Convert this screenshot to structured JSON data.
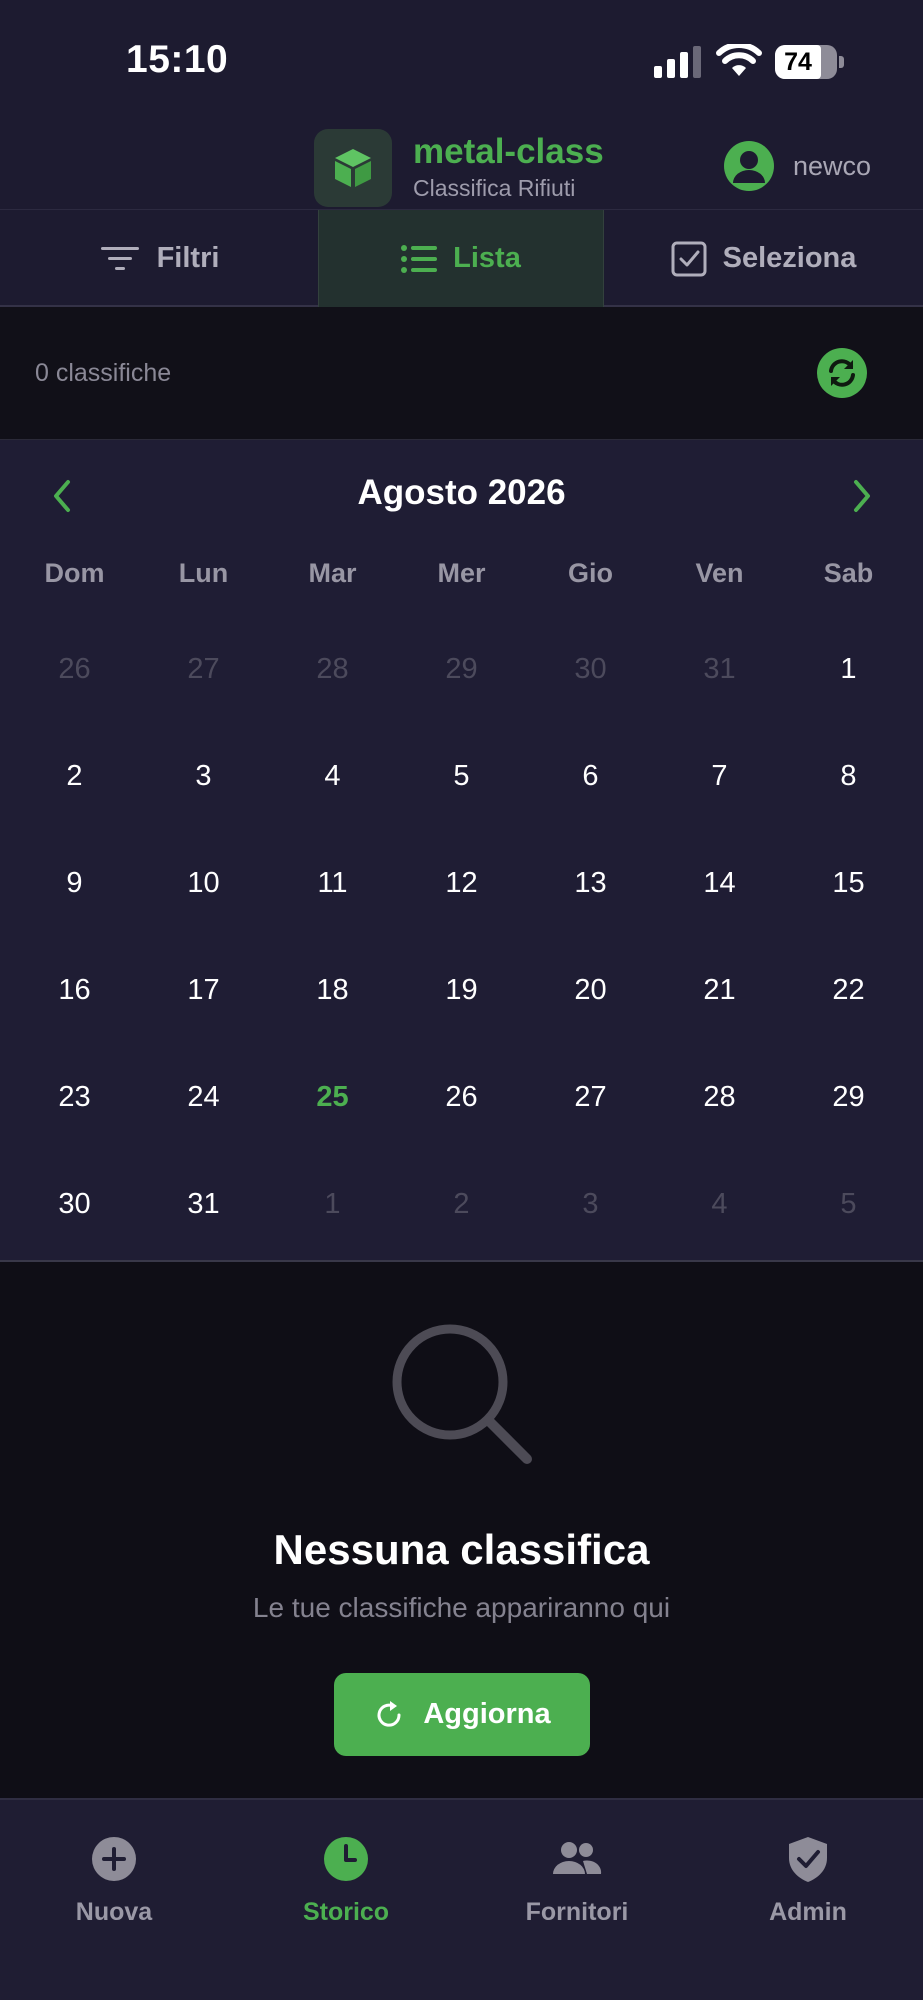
{
  "status_bar": {
    "time": "15:10",
    "battery": "74"
  },
  "header": {
    "app_name": "metal-class",
    "subtitle": "Classifica Rifiuti",
    "user": "newco"
  },
  "tabs": [
    {
      "label": "Filtri",
      "icon": "filter-icon"
    },
    {
      "label": "Lista",
      "icon": "list-icon",
      "active": true
    },
    {
      "label": "Seleziona",
      "icon": "checkbox-icon"
    }
  ],
  "results": {
    "count_label": "0 classifiche"
  },
  "calendar": {
    "month_label": "Agosto 2026",
    "weekdays": [
      "Dom",
      "Lun",
      "Mar",
      "Mer",
      "Gio",
      "Ven",
      "Sab"
    ],
    "days": [
      {
        "d": "26",
        "out": true
      },
      {
        "d": "27",
        "out": true
      },
      {
        "d": "28",
        "out": true
      },
      {
        "d": "29",
        "out": true
      },
      {
        "d": "30",
        "out": true
      },
      {
        "d": "31",
        "out": true
      },
      {
        "d": "1"
      },
      {
        "d": "2"
      },
      {
        "d": "3"
      },
      {
        "d": "4"
      },
      {
        "d": "5"
      },
      {
        "d": "6"
      },
      {
        "d": "7"
      },
      {
        "d": "8"
      },
      {
        "d": "9"
      },
      {
        "d": "10"
      },
      {
        "d": "11"
      },
      {
        "d": "12"
      },
      {
        "d": "13"
      },
      {
        "d": "14"
      },
      {
        "d": "15"
      },
      {
        "d": "16"
      },
      {
        "d": "17"
      },
      {
        "d": "18"
      },
      {
        "d": "19"
      },
      {
        "d": "20"
      },
      {
        "d": "21"
      },
      {
        "d": "22"
      },
      {
        "d": "23"
      },
      {
        "d": "24"
      },
      {
        "d": "25",
        "today": true
      },
      {
        "d": "26"
      },
      {
        "d": "27"
      },
      {
        "d": "28"
      },
      {
        "d": "29"
      },
      {
        "d": "30"
      },
      {
        "d": "31"
      },
      {
        "d": "1",
        "out": true
      },
      {
        "d": "2",
        "out": true
      },
      {
        "d": "3",
        "out": true
      },
      {
        "d": "4",
        "out": true
      },
      {
        "d": "5",
        "out": true
      }
    ]
  },
  "empty_state": {
    "title": "Nessuna classifica",
    "subtitle": "Le tue classifiche appariranno qui",
    "button_label": "Aggiorna"
  },
  "bottom_nav": [
    {
      "label": "Nuova",
      "icon": "plus-circle-icon"
    },
    {
      "label": "Storico",
      "icon": "clock-icon",
      "active": true
    },
    {
      "label": "Fornitori",
      "icon": "people-icon"
    },
    {
      "label": "Admin",
      "icon": "shield-check-icon"
    }
  ],
  "colors": {
    "accent": "#4caf50",
    "background": "#1d1b30",
    "empty_bg": "#0f0e16"
  }
}
